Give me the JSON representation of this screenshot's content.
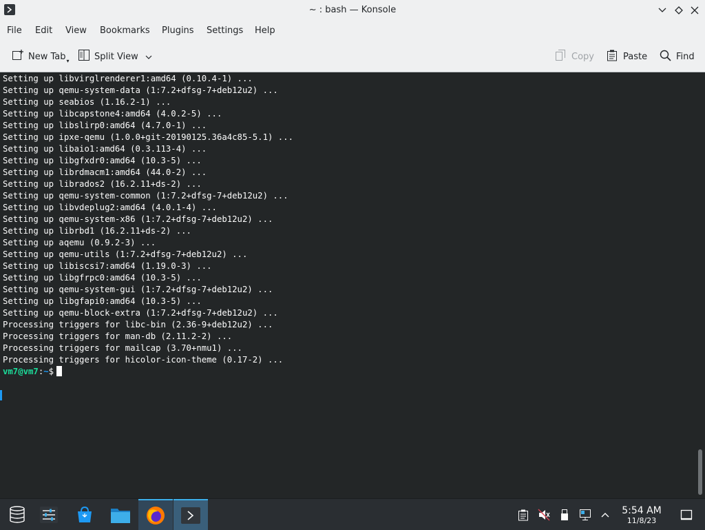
{
  "window": {
    "title": "~ : bash — Konsole"
  },
  "menu": [
    "File",
    "Edit",
    "View",
    "Bookmarks",
    "Plugins",
    "Settings",
    "Help"
  ],
  "toolbar": {
    "new_tab": "New Tab",
    "split_view": "Split View",
    "copy": "Copy",
    "paste": "Paste",
    "find": "Find"
  },
  "terminal": {
    "lines": [
      "Setting up libvirglrenderer1:amd64 (0.10.4-1) ...",
      "Setting up qemu-system-data (1:7.2+dfsg-7+deb12u2) ...",
      "Setting up seabios (1.16.2-1) ...",
      "Setting up libcapstone4:amd64 (4.0.2-5) ...",
      "Setting up libslirp0:amd64 (4.7.0-1) ...",
      "Setting up ipxe-qemu (1.0.0+git-20190125.36a4c85-5.1) ...",
      "Setting up libaio1:amd64 (0.3.113-4) ...",
      "Setting up libgfxdr0:amd64 (10.3-5) ...",
      "Setting up librdmacm1:amd64 (44.0-2) ...",
      "Setting up librados2 (16.2.11+ds-2) ...",
      "Setting up qemu-system-common (1:7.2+dfsg-7+deb12u2) ...",
      "Setting up libvdeplug2:amd64 (4.0.1-4) ...",
      "Setting up qemu-system-x86 (1:7.2+dfsg-7+deb12u2) ...",
      "Setting up librbd1 (16.2.11+ds-2) ...",
      "Setting up aqemu (0.9.2-3) ...",
      "Setting up qemu-utils (1:7.2+dfsg-7+deb12u2) ...",
      "Setting up libiscsi7:amd64 (1.19.0-3) ...",
      "Setting up libgfrpc0:amd64 (10.3-5) ...",
      "Setting up qemu-system-gui (1:7.2+dfsg-7+deb12u2) ...",
      "Setting up libgfapi0:amd64 (10.3-5) ...",
      "Setting up qemu-block-extra (1:7.2+dfsg-7+deb12u2) ...",
      "Processing triggers for libc-bin (2.36-9+deb12u2) ...",
      "Processing triggers for man-db (2.11.2-2) ...",
      "Processing triggers for mailcap (3.70+nmu1) ...",
      "Processing triggers for hicolor-icon-theme (0.17-2) ..."
    ],
    "prompt_user": "vm7@vm7",
    "prompt_sep": ":",
    "prompt_path": "~",
    "prompt_symbol": "$"
  },
  "taskbar": {
    "icons": [
      "application-launcher-icon",
      "system-settings-icon",
      "discover-store-icon",
      "dolphin-files-icon",
      "firefox-icon",
      "konsole-icon"
    ],
    "tray": [
      "clipboard-icon",
      "volume-muted-icon",
      "usb-device-icon",
      "network-icon",
      "tray-expand-icon",
      "show-desktop-icon"
    ],
    "clock_time": "5:54 AM",
    "clock_date": "11/8/23"
  },
  "colors": {
    "accent": "#3daee9",
    "prompt_user": "#1cdc9a",
    "prompt_path": "#1d99f3",
    "terminal_bg": "#232627"
  }
}
